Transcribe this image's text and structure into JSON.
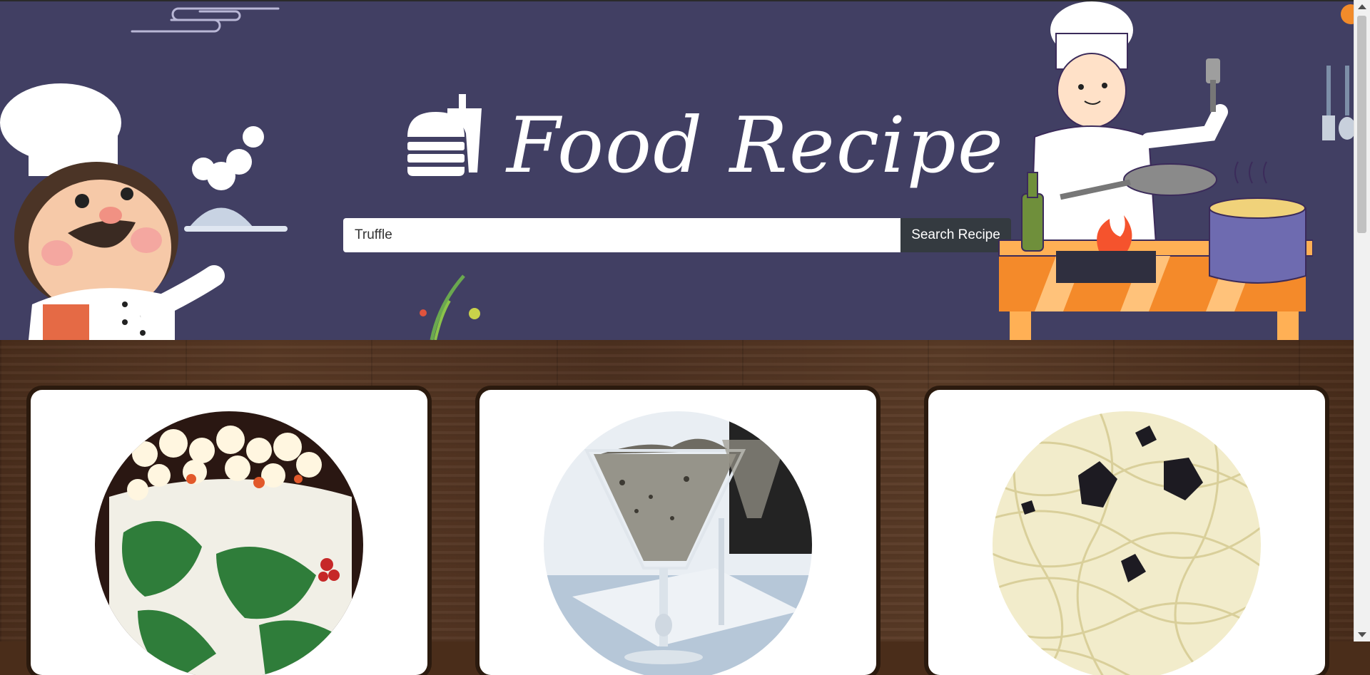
{
  "header": {
    "logo_text": "Food Recipe",
    "logo_icon": "burger-drink-icon",
    "colors": {
      "hero_bg": "#413f63",
      "logo": "#ffffff",
      "button_bg": "#343a40"
    }
  },
  "search": {
    "value": "Truffle",
    "button_label": "Search Recipe"
  },
  "recipes": [
    {
      "image": "popcorn-in-holly-wrapped-bowl"
    },
    {
      "image": "truffle-mousse-in-glass"
    },
    {
      "image": "spaghetti-with-truffle-shavings"
    }
  ]
}
